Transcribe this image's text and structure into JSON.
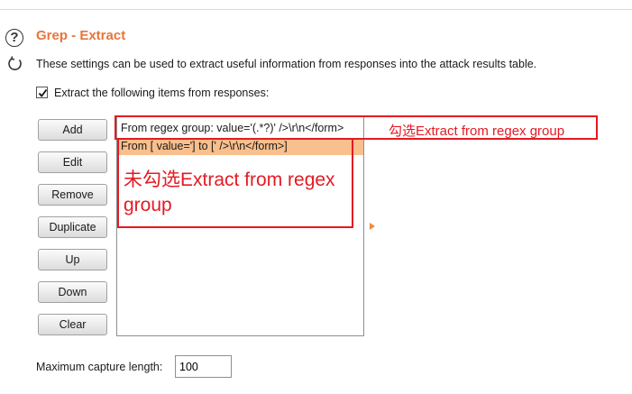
{
  "section": {
    "title": "Grep - Extract",
    "description": "These settings can be used to extract useful information from responses into the attack results table."
  },
  "extract_checkbox": {
    "label": "Extract the following items from responses:",
    "checked": true
  },
  "buttons": {
    "add": "Add",
    "edit": "Edit",
    "remove": "Remove",
    "duplicate": "Duplicate",
    "up": "Up",
    "down": "Down",
    "clear": "Clear"
  },
  "list": {
    "items": [
      "From regex group:  value='(.*?)' />\\r\\n</form>",
      "From [ value='] to [' />\\r\\n</form>]"
    ]
  },
  "annotations": {
    "checked_note": "勾选Extract from regex group",
    "unchecked_note": "未勾选Extract from regex group",
    "color": "#e31b23"
  },
  "max_capture": {
    "label": "Maximum capture length:",
    "value": "100"
  },
  "colors": {
    "title": "#e8743b",
    "selected_row": "#f9bf8c",
    "arrow": "#f08a3c"
  },
  "icons": [
    "help-icon",
    "refresh-icon",
    "expand-arrow-icon"
  ]
}
